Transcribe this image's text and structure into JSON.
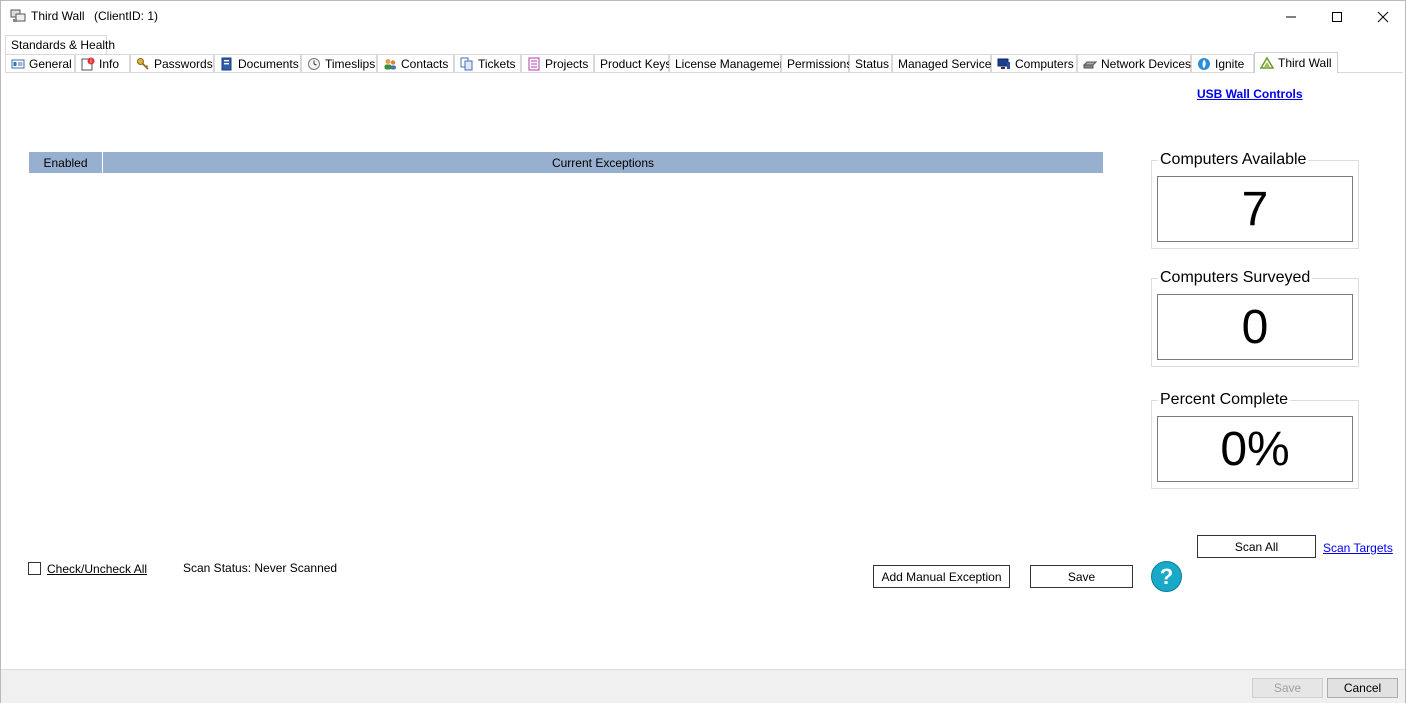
{
  "window": {
    "title": "Third Wall",
    "client": "(ClientID: 1)"
  },
  "tabs_row1": [
    {
      "label": "Standards & Health",
      "icon": "none"
    }
  ],
  "tabs_row2": [
    {
      "label": "General",
      "icon": "id-card-icon"
    },
    {
      "label": "Info",
      "icon": "info-icon"
    },
    {
      "label": "Passwords",
      "icon": "key-icon"
    },
    {
      "label": "Documents",
      "icon": "document-icon"
    },
    {
      "label": "Timeslips",
      "icon": "clock-icon"
    },
    {
      "label": "Contacts",
      "icon": "contacts-icon"
    },
    {
      "label": "Tickets",
      "icon": "tickets-icon"
    },
    {
      "label": "Projects",
      "icon": "projects-icon"
    },
    {
      "label": "Product Keys",
      "icon": "none"
    },
    {
      "label": "License Management",
      "icon": "none"
    },
    {
      "label": "Permissions",
      "icon": "none"
    },
    {
      "label": "Status",
      "icon": "none"
    },
    {
      "label": "Managed Services",
      "icon": "none"
    },
    {
      "label": "Computers",
      "icon": "computer-icon"
    },
    {
      "label": "Network Devices",
      "icon": "network-device-icon"
    },
    {
      "label": "Ignite",
      "icon": "ignite-icon"
    },
    {
      "label": "Third Wall",
      "icon": "third-wall-icon",
      "active": true
    }
  ],
  "main": {
    "usb_link": "USB Wall Controls",
    "grid": {
      "columns": [
        "Enabled",
        "Current Exceptions"
      ],
      "rows": []
    },
    "stats": {
      "available_label": "Computers Available",
      "available_value": "7",
      "surveyed_label": "Computers Surveyed",
      "surveyed_value": "0",
      "percent_label": "Percent Complete",
      "percent_value": "0%"
    },
    "check_all_label": "Check/Uncheck All",
    "check_all_checked": false,
    "scan_status": "Scan Status: Never Scanned",
    "scan_all_label": "Scan All",
    "scan_targets_label": "Scan Targets",
    "add_exception_label": "Add Manual Exception",
    "save_label": "Save",
    "help_glyph": "?"
  },
  "footer": {
    "save_label": "Save",
    "save_enabled": false,
    "cancel_label": "Cancel"
  },
  "colors": {
    "grid_header": "#98b0cf",
    "link": "#0000ee",
    "help": "#18a8c8"
  }
}
